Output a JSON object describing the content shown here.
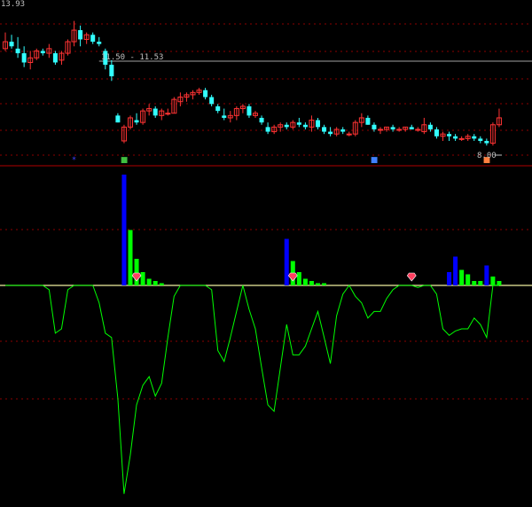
{
  "chart_data": [
    {
      "type": "candlestick",
      "price_top_label": "13.93",
      "range_label": "11.50 - 11.53",
      "low_label": "8.00",
      "ylim": [
        7.7,
        14.0
      ],
      "colors": {
        "up": "#ff3333",
        "down": "#33ffff",
        "background": "#000000",
        "grid": "#8b0000",
        "range_line": "#a0a0a0"
      },
      "candles": [
        [
          12.2,
          12.9,
          12.1,
          12.5
        ],
        [
          12.5,
          12.8,
          12.2,
          12.3
        ],
        [
          12.2,
          12.7,
          11.8,
          12.0
        ],
        [
          12.0,
          12.3,
          11.4,
          11.6
        ],
        [
          11.6,
          12.1,
          11.3,
          11.8
        ],
        [
          11.8,
          12.2,
          11.7,
          12.1
        ],
        [
          12.1,
          12.2,
          11.9,
          12.0
        ],
        [
          12.0,
          12.4,
          11.8,
          12.2
        ],
        [
          12.0,
          12.1,
          11.5,
          11.6
        ],
        [
          11.7,
          12.1,
          11.5,
          12.0
        ],
        [
          12.0,
          12.6,
          11.9,
          12.5
        ],
        [
          12.5,
          13.4,
          12.3,
          13.0
        ],
        [
          13.0,
          13.2,
          12.3,
          12.6
        ],
        [
          12.6,
          12.9,
          12.4,
          12.8
        ],
        [
          12.8,
          12.9,
          12.4,
          12.5
        ],
        [
          12.5,
          12.7,
          12.3,
          12.4
        ],
        [
          12.1,
          12.2,
          11.3,
          11.5
        ],
        [
          11.5,
          11.7,
          10.8,
          11.0
        ],
        [
          9.3,
          9.4,
          9.0,
          9.0
        ],
        [
          8.2,
          8.9,
          8.1,
          8.8
        ],
        [
          8.8,
          9.3,
          8.7,
          9.2
        ],
        [
          9.1,
          9.4,
          8.9,
          9.0
        ],
        [
          9.0,
          9.6,
          8.9,
          9.5
        ],
        [
          9.5,
          9.8,
          9.3,
          9.6
        ],
        [
          9.6,
          9.7,
          9.2,
          9.3
        ],
        [
          9.3,
          9.6,
          9.1,
          9.5
        ],
        [
          9.4,
          9.6,
          9.3,
          9.4
        ],
        [
          9.4,
          10.1,
          9.4,
          10.0
        ],
        [
          9.9,
          10.3,
          9.7,
          10.1
        ],
        [
          10.1,
          10.3,
          9.9,
          10.2
        ],
        [
          10.2,
          10.4,
          10.0,
          10.3
        ],
        [
          10.3,
          10.5,
          10.2,
          10.4
        ],
        [
          10.4,
          10.5,
          10.0,
          10.1
        ],
        [
          10.1,
          10.2,
          9.7,
          9.8
        ],
        [
          9.7,
          9.8,
          9.4,
          9.5
        ],
        [
          9.3,
          9.6,
          9.1,
          9.2
        ],
        [
          9.2,
          9.5,
          9.0,
          9.3
        ],
        [
          9.3,
          9.7,
          9.1,
          9.6
        ],
        [
          9.6,
          9.8,
          9.4,
          9.7
        ],
        [
          9.7,
          9.8,
          9.2,
          9.3
        ],
        [
          9.3,
          9.5,
          9.2,
          9.4
        ],
        [
          9.2,
          9.3,
          8.9,
          9.0
        ],
        [
          8.8,
          9.0,
          8.5,
          8.6
        ],
        [
          8.6,
          8.9,
          8.5,
          8.8
        ],
        [
          8.8,
          9.0,
          8.6,
          8.9
        ],
        [
          8.9,
          9.0,
          8.7,
          8.8
        ],
        [
          8.8,
          9.1,
          8.7,
          9.0
        ],
        [
          9.0,
          9.2,
          8.8,
          8.9
        ],
        [
          8.9,
          9.0,
          8.7,
          8.8
        ],
        [
          8.8,
          9.3,
          8.6,
          9.1
        ],
        [
          9.1,
          9.2,
          8.7,
          8.8
        ],
        [
          8.8,
          8.9,
          8.5,
          8.6
        ],
        [
          8.6,
          8.8,
          8.4,
          8.5
        ],
        [
          8.5,
          8.8,
          8.4,
          8.7
        ],
        [
          8.7,
          8.8,
          8.5,
          8.6
        ],
        [
          8.5,
          8.6,
          8.4,
          8.5
        ],
        [
          8.5,
          9.1,
          8.4,
          9.0
        ],
        [
          9.0,
          9.4,
          8.8,
          9.2
        ],
        [
          9.2,
          9.3,
          8.9,
          8.9
        ],
        [
          8.9,
          9.0,
          8.6,
          8.7
        ],
        [
          8.7,
          8.8,
          8.5,
          8.7
        ],
        [
          8.7,
          8.8,
          8.6,
          8.8
        ],
        [
          8.8,
          8.9,
          8.6,
          8.7
        ],
        [
          8.7,
          8.8,
          8.6,
          8.7
        ],
        [
          8.7,
          8.8,
          8.6,
          8.8
        ],
        [
          8.8,
          8.9,
          8.7,
          8.7
        ],
        [
          8.7,
          8.8,
          8.6,
          8.7
        ],
        [
          8.6,
          9.2,
          8.5,
          8.9
        ],
        [
          8.9,
          9.0,
          8.6,
          8.7
        ],
        [
          8.7,
          8.8,
          8.3,
          8.4
        ],
        [
          8.4,
          8.6,
          8.2,
          8.5
        ],
        [
          8.5,
          8.6,
          8.2,
          8.4
        ],
        [
          8.4,
          8.5,
          8.2,
          8.3
        ],
        [
          8.3,
          8.4,
          8.2,
          8.3
        ],
        [
          8.3,
          8.5,
          8.2,
          8.4
        ],
        [
          8.4,
          8.5,
          8.2,
          8.3
        ],
        [
          8.3,
          8.4,
          8.1,
          8.2
        ],
        [
          8.2,
          8.3,
          8.0,
          8.1
        ],
        [
          8.1,
          9.0,
          8.0,
          8.9
        ],
        [
          8.9,
          9.6,
          8.8,
          9.2
        ]
      ],
      "bottom_markers": [
        {
          "index": 11,
          "color": "#4040ff",
          "symbol": "*"
        },
        {
          "index": 19,
          "color": "#40c040",
          "symbol": "■"
        },
        {
          "index": 59,
          "color": "#4080ff",
          "symbol": "■"
        },
        {
          "index": 77,
          "color": "#ff8040",
          "symbol": "■"
        }
      ]
    },
    {
      "type": "bar+line",
      "colors": {
        "blue": "#0000ff",
        "green": "#00ff00",
        "line": "#00ff00",
        "baseline": "#f0f0a0",
        "diamond": "#ff4060"
      },
      "ylim": [
        -100,
        50
      ],
      "bars": [
        {
          "index": 19,
          "value": 50,
          "color": "blue"
        },
        {
          "index": 20,
          "value": 25,
          "color": "green"
        },
        {
          "index": 21,
          "value": 12,
          "color": "green"
        },
        {
          "index": 22,
          "value": 6,
          "color": "green"
        },
        {
          "index": 23,
          "value": 3,
          "color": "green"
        },
        {
          "index": 24,
          "value": 2,
          "color": "green"
        },
        {
          "index": 25,
          "value": 1,
          "color": "green"
        },
        {
          "index": 45,
          "value": 21,
          "color": "blue"
        },
        {
          "index": 46,
          "value": 11,
          "color": "green"
        },
        {
          "index": 47,
          "value": 6,
          "color": "green"
        },
        {
          "index": 48,
          "value": 3,
          "color": "green"
        },
        {
          "index": 49,
          "value": 2,
          "color": "green"
        },
        {
          "index": 50,
          "value": 1,
          "color": "green"
        },
        {
          "index": 51,
          "value": 1,
          "color": "green"
        },
        {
          "index": 71,
          "value": 6,
          "color": "blue"
        },
        {
          "index": 72,
          "value": 13,
          "color": "blue"
        },
        {
          "index": 73,
          "value": 7,
          "color": "green"
        },
        {
          "index": 74,
          "value": 5,
          "color": "green"
        },
        {
          "index": 75,
          "value": 2,
          "color": "green"
        },
        {
          "index": 76,
          "value": 2,
          "color": "green"
        },
        {
          "index": 77,
          "value": 9,
          "color": "blue"
        },
        {
          "index": 78,
          "value": 4,
          "color": "green"
        },
        {
          "index": 79,
          "value": 2,
          "color": "green"
        }
      ],
      "diamonds": [
        21,
        46,
        65
      ],
      "line": [
        0,
        0,
        0,
        0,
        0,
        0,
        0,
        -2,
        -22,
        -20,
        -2,
        0,
        0,
        0,
        0,
        -8,
        -22,
        -24,
        -52,
        -96,
        -78,
        -55,
        -46,
        -42,
        -51,
        -45,
        -24,
        -5,
        0,
        0,
        0,
        0,
        0,
        -2,
        -30,
        -35,
        -24,
        -12,
        0,
        -11,
        -20,
        -38,
        -55,
        -58,
        -38,
        -18,
        -32,
        -32,
        -28,
        -20,
        -12,
        -24,
        -36,
        -14,
        -4,
        0,
        -5,
        -8,
        -15,
        -12,
        -12,
        -6,
        -2,
        0,
        0,
        0,
        -1,
        0,
        0,
        -4,
        -20,
        -23,
        -21,
        -20,
        -20,
        -15,
        -18,
        -24,
        0,
        0
      ]
    }
  ]
}
